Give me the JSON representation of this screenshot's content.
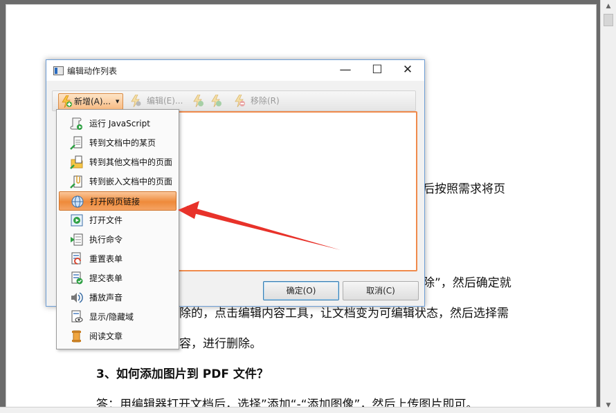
{
  "document": {
    "line1_fragment": "后按照需求将页",
    "line2_fragment": "除”，然后确定就",
    "line3_fragment": "除的，点击编辑内容工具，让文档变为可编辑状态，然后选择需",
    "line4_fragment": "容，进行删除。",
    "heading3": "3、如何添加图片到 PDF 文件？",
    "answer3": "答：用编辑器打开文档后，选择”添加“-“添加图像”，然后上传图片即可。"
  },
  "dialog": {
    "title": "编辑动作列表",
    "window_controls": {
      "minimize": "—",
      "maximize": "☐",
      "close": "✕"
    },
    "toolbar": {
      "new_label": "新增(A)...",
      "edit_label": "编辑(E)...",
      "remove_label": "移除(R)"
    },
    "buttons": {
      "ok": "确定(O)",
      "cancel": "取消(C)"
    }
  },
  "menu": {
    "items": [
      {
        "label": "运行 JavaScript",
        "icon": "script-icon"
      },
      {
        "label": "转到文档中的某页",
        "icon": "page-goto-icon"
      },
      {
        "label": "转到其他文档中的页面",
        "icon": "folder-page-icon"
      },
      {
        "label": "转到嵌入文档中的页面",
        "icon": "attachment-page-icon"
      },
      {
        "label": "打开网页链接",
        "icon": "globe-link-icon",
        "selected": true
      },
      {
        "label": "打开文件",
        "icon": "open-file-icon"
      },
      {
        "label": "执行命令",
        "icon": "command-icon"
      },
      {
        "label": "重置表单",
        "icon": "reset-form-icon"
      },
      {
        "label": "提交表单",
        "icon": "submit-form-icon"
      },
      {
        "label": "播放声音",
        "icon": "sound-icon"
      },
      {
        "label": "显示/隐藏域",
        "icon": "show-hide-icon"
      },
      {
        "label": "阅读文章",
        "icon": "read-article-icon"
      }
    ]
  },
  "colors": {
    "accent_orange": "#ee8a3a",
    "annotation_arrow": "#e8322a",
    "dialog_border": "#6d9ed6"
  }
}
